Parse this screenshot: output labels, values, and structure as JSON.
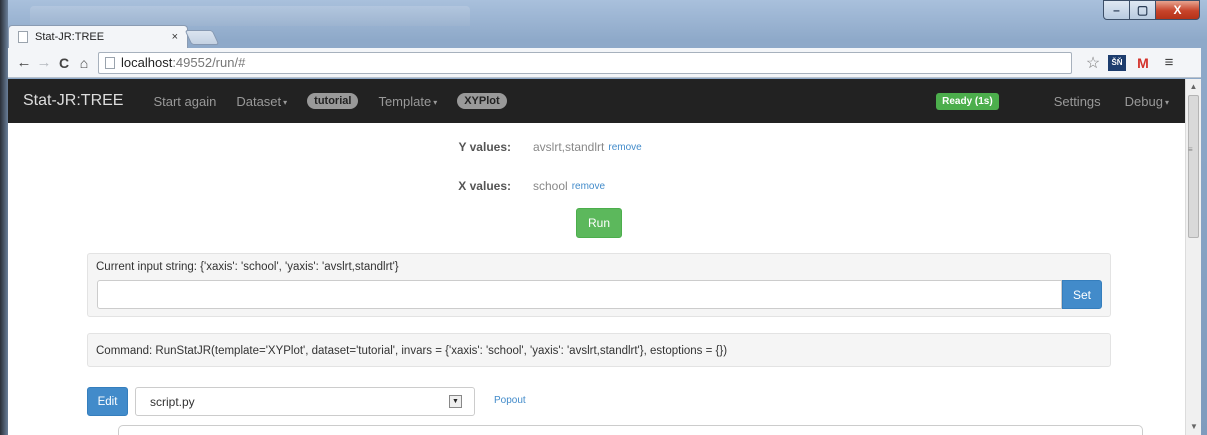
{
  "browser": {
    "tab_title": "Stat-JR:TREE",
    "tab_close": "×",
    "url_host": "localhost",
    "url_rest": ":49552/run/#",
    "window_controls": {
      "minimize": "–",
      "maximize": "▢",
      "close": "X"
    },
    "nav": {
      "back": "←",
      "forward": "→",
      "reload": "C",
      "home": "⌂"
    },
    "star": "☆",
    "ext1": "ŠŇ",
    "ext2": "M",
    "menu": "≡"
  },
  "navbar": {
    "brand": "Stat-JR:TREE",
    "start_again": "Start again",
    "dataset": "Dataset",
    "dataset_pill": "tutorial",
    "template": "Template",
    "template_pill": "XYPlot",
    "status": "Ready (1s)",
    "settings": "Settings",
    "debug": "Debug",
    "caret": "▾"
  },
  "form": {
    "y_label": "Y values:",
    "y_value": "avslrt,standlrt",
    "x_label": "X values:",
    "x_value": "school",
    "remove_label": "remove",
    "run_label": "Run"
  },
  "input_string": {
    "text": "Current input string: {'xaxis': 'school', 'yaxis': 'avslrt,standlrt'}",
    "value": "",
    "set_label": "Set"
  },
  "command": {
    "text": "Command: RunStatJR(template='XYPlot', dataset='tutorial', invars = {'xaxis': 'school', 'yaxis': 'avslrt,standlrt'}, estoptions = {})"
  },
  "script": {
    "edit_label": "Edit",
    "selected": "script.py",
    "select_arrow": "▼",
    "popout_label": "Popout"
  },
  "scrollbar": {
    "up": "▲",
    "down": "▼",
    "grip": "≡"
  }
}
